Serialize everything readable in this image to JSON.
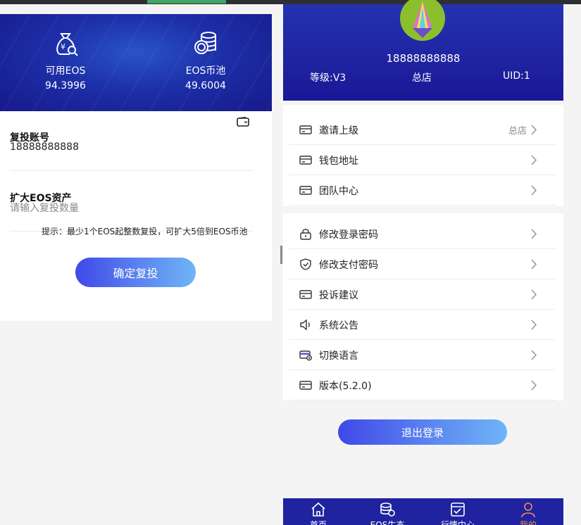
{
  "colors": {
    "header_blue": "#1f23a0",
    "button_start": "#4048e8",
    "button_end": "#6fb4f6",
    "active_tab": "#f5875a"
  },
  "left": {
    "stats": [
      {
        "icon": "money-bag-icon",
        "label": "可用EOS",
        "value": "94.3996"
      },
      {
        "icon": "coin-stack-icon",
        "label": "EOS币池",
        "value": "49.6004"
      }
    ],
    "account_title": "复投账号",
    "account_value": "18888888888",
    "amount_title": "扩大EOS资产",
    "amount_placeholder": "请输入复投数量",
    "hint": "提示：最少1个EOS起整数复投，可扩大5倍到EOS币池",
    "confirm_label": "确定复投"
  },
  "right": {
    "phone": "18888888888",
    "level": "等级:V3",
    "shop": "总店",
    "uid": "UID:1",
    "menu_group_1": [
      {
        "icon": "card-icon",
        "label": "邀请上级",
        "value": "总店"
      },
      {
        "icon": "card-icon",
        "label": "钱包地址"
      },
      {
        "icon": "card-icon",
        "label": "团队中心"
      }
    ],
    "menu_group_2": [
      {
        "icon": "lock-icon",
        "label": "修改登录密码"
      },
      {
        "icon": "shield-icon",
        "label": "修改支付密码"
      },
      {
        "icon": "card-icon",
        "label": "投诉建议"
      },
      {
        "icon": "speaker-icon",
        "label": "系统公告"
      },
      {
        "icon": "language-card-icon",
        "label": "切换语言"
      },
      {
        "icon": "card-icon",
        "label": "版本(5.2.0)"
      }
    ],
    "logout_label": "退出登录",
    "tabs": [
      {
        "icon": "home-icon",
        "label": "首页"
      },
      {
        "icon": "coins-icon",
        "label": "EOS生态"
      },
      {
        "icon": "market-icon",
        "label": "行情中心"
      },
      {
        "icon": "user-icon",
        "label": "我的",
        "active": true
      }
    ]
  }
}
